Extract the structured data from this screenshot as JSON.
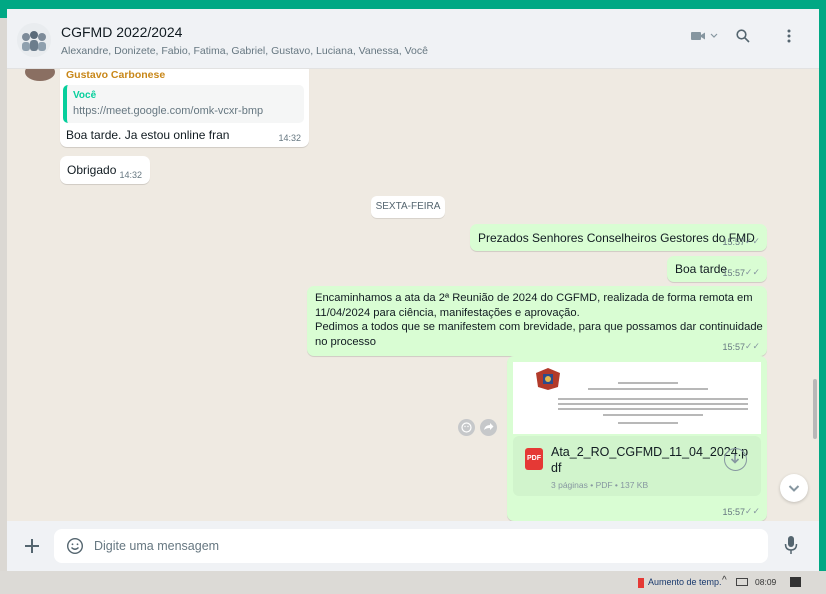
{
  "header": {
    "title": "CGFMD 2022/2024",
    "members": "Alexandre, Donizete, Fabio, Fatima, Gabriel, Gustavo, Luciana, Vanessa, Você"
  },
  "messages": {
    "reply": {
      "sender": "Gustavo Carbonese",
      "quoted_author": "Você",
      "quoted_text": "https://meet.google.com/omk-vcxr-bmp",
      "text": "Boa tarde. Ja estou online fran",
      "time": "14:32"
    },
    "thanks": {
      "text": "Obrigado",
      "time": "14:32"
    },
    "date_chip": "SEXTA-FEIRA",
    "greeting1": {
      "text": "Prezados Senhores Conselheiros Gestores do FMD",
      "time": "15:57"
    },
    "greeting2": {
      "text": "Boa tarde",
      "time": "15:57"
    },
    "long": {
      "line1": "Encaminhamos a ata da 2ª Reunião de 2024 do CGFMD, realizada de forma remota em",
      "line2": "11/04/2024 para ciência, manifestações e aprovação.",
      "line3": "Pedimos a todos que se manifestem com brevidade, para que possamos dar continuidade",
      "line4": "no processo",
      "time": "15:57"
    },
    "document": {
      "icon_label": "PDF",
      "name_line1": "Ata_2_RO_CGFMD_11_04_2024.p",
      "name_line2": "df",
      "meta": "3 páginas • PDF • 137 KB",
      "time": "15:57"
    }
  },
  "composer": {
    "placeholder": "Digite uma mensagem"
  },
  "taskbar": {
    "weather": "Aumento de temp.",
    "clock": "08:09"
  },
  "icons": {
    "video": "video-call-icon",
    "search": "search-icon",
    "menu": "menu-icon",
    "plus": "attach-icon",
    "emoji": "emoji-icon",
    "mic": "mic-icon"
  },
  "colors": {
    "accent": "#00a884",
    "outgoing_bubble": "#d9fdd3",
    "incoming_bubble": "#ffffff",
    "pdf_red": "#e53935",
    "sender_name": "#c88719"
  }
}
